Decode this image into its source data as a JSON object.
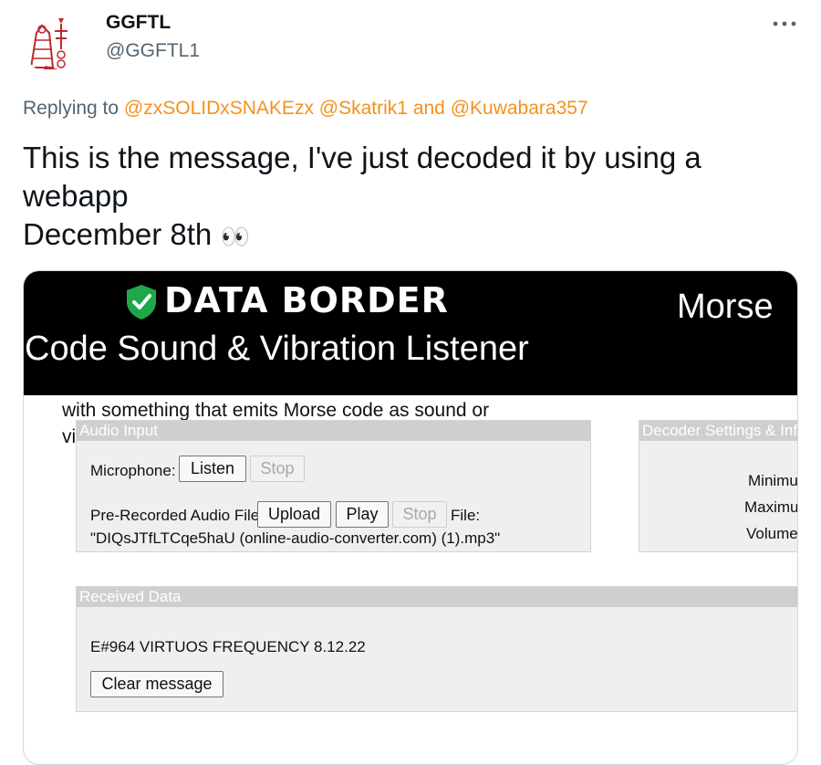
{
  "author": {
    "display_name": "GGFTL",
    "handle": "@GGFTL1"
  },
  "reply": {
    "prefix": "Replying to",
    "mention_1": "@zxSOLIDxSNAKEzx",
    "mention_2": "@Skatrik1",
    "joiner": "and",
    "mention_3": "@Kuwabara357"
  },
  "tweet": {
    "line_1": "This is the message, I've just decoded it by using a",
    "line_2": "webapp",
    "line_3": "December 8th",
    "emoji": "👀"
  },
  "media": {
    "brand": "DATA BORDER",
    "title_right": "Morse",
    "subtitle": "Code Sound & Vibration Listener",
    "intro_line": "with something that emits Morse code as sound or",
    "intro_fragment": "vi",
    "audio_input": {
      "title": "Audio Input",
      "microphone_label": "Microphone:",
      "listen_label": "Listen",
      "stop_label": "Stop",
      "prerecorded_label": "Pre-Recorded Audio File",
      "upload_label": "Upload",
      "play_label": "Play",
      "stop2_label": "Stop",
      "file_label": "File:",
      "file_name": "\"DIQsJTfLTCqe5haU (online-audio-converter.com) (1).mp3\""
    },
    "decoder_settings": {
      "title": "Decoder Settings & Info",
      "min_label": "Minimu",
      "max_label": "Maximu",
      "volume_label": "Volume"
    },
    "received_data": {
      "title": "Received Data",
      "message": "E#964 VIRTUOS FREQUENCY 8.12.22",
      "clear_label": "Clear message"
    }
  },
  "colors": {
    "mention": "#f4911c",
    "muted": "#536471",
    "shield_green": "#1fa84a"
  }
}
